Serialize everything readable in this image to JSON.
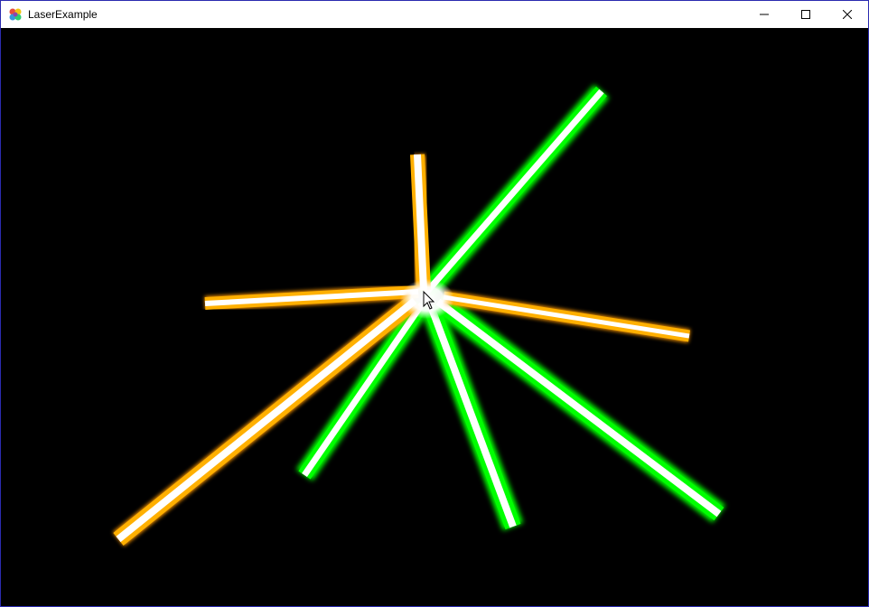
{
  "window": {
    "title": "LaserExample",
    "icon": "app-flower-icon",
    "controls": [
      {
        "name": "minimize-button",
        "icon": "minimize-icon"
      },
      {
        "name": "maximize-button",
        "icon": "maximize-icon"
      },
      {
        "name": "close-button",
        "icon": "close-icon"
      }
    ]
  },
  "scene": {
    "background": "#000000",
    "beam_colors": {
      "green": "#00ff00",
      "orange": "#ff9900",
      "core": "#ffffff"
    },
    "cursor": "arrow-cursor-icon"
  }
}
